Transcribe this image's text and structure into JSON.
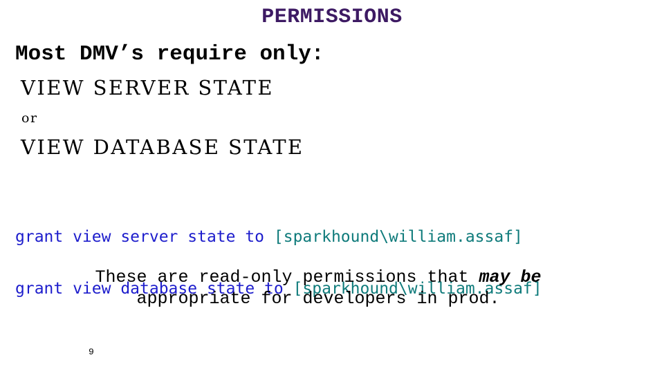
{
  "slide": {
    "title": "PERMISSIONS",
    "title_color": "#3d1a63",
    "background_color": "#ffffff",
    "page_number": "9"
  },
  "lead": {
    "text": "Most DMV’s require only:"
  },
  "permissions": {
    "first": "VIEW SERVER STATE",
    "separator": "or",
    "second": "VIEW DATABASE STATE"
  },
  "code": {
    "keyword_color": "#1d1dcc",
    "principal_color": "#0f7b7b",
    "lines": [
      {
        "statement": "grant view server state to ",
        "principal": "[sparkhound\\william.assaf]"
      },
      {
        "statement": "grant view database state to ",
        "principal": "[sparkhound\\william.assaf]"
      }
    ]
  },
  "closing": {
    "part1": "These are read-only permissions that ",
    "emphasis": "may be",
    "part2": "\nappropriate for developers in prod."
  }
}
